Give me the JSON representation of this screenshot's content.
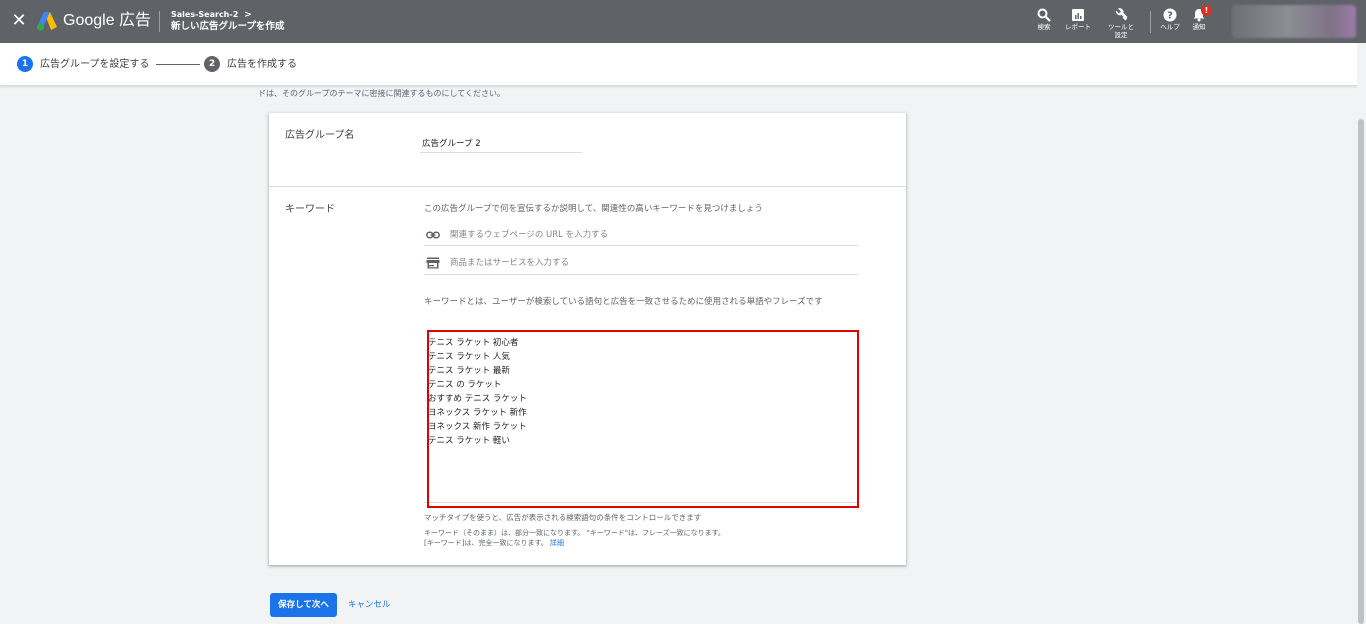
{
  "topbar": {
    "brand": "Google 広告",
    "campaign": "Sales-Search-2",
    "page_title": "新しい広告グループを作成",
    "tools": {
      "search": "検索",
      "reports": "レポート",
      "tools_line1": "ツールと",
      "tools_line2": "設定",
      "help": "ヘルプ",
      "notifications": "通知",
      "notification_badge": "!"
    }
  },
  "stepper": {
    "steps": [
      {
        "number": "1",
        "label": "広告グループを設定する"
      },
      {
        "number": "2",
        "label": "広告を作成する"
      }
    ]
  },
  "intro_text": "ドは、そのグループのテーマに密接に関連するものにしてください。",
  "ad_group": {
    "label": "広告グループ名",
    "value": "広告グループ 2"
  },
  "keywords": {
    "label": "キーワード",
    "description": "この広告グループで何を宣伝するか説明して、関連性の高いキーワードを見つけましょう",
    "url_placeholder": "関連するウェブページの URL を入力する",
    "product_placeholder": "商品またはサービスを入力する",
    "explanation": "キーワードとは、ユーザーが検索している語句と広告を一致させるために使用される単語やフレーズです",
    "entries": [
      "テニス ラケット 初心者",
      "テニス ラケット 人気",
      "テニス ラケット 最新",
      "テニス の ラケット",
      "おすすめ テニス ラケット",
      "ヨネックス ラケット 新作",
      "ヨネックス 新作 ラケット",
      "テニス ラケット 軽い"
    ],
    "match_note": "マッチタイプを使うと、広告が表示される検索語句の条件をコントロールできます",
    "match_detail_1": "キーワード（そのまま）は、部分一致になります。 \"キーワード\"は、フレーズ一致になります。",
    "match_detail_2": "[キーワード]は、完全一致になります。",
    "details_link": "詳細"
  },
  "actions": {
    "save": "保存して次へ",
    "cancel": "キャンセル"
  },
  "colors": {
    "topbar": "#5f6368",
    "primary": "#1a73e8",
    "highlight": "#e00000",
    "step_active": "#1a73e8",
    "step_inactive": "#5f6368"
  }
}
